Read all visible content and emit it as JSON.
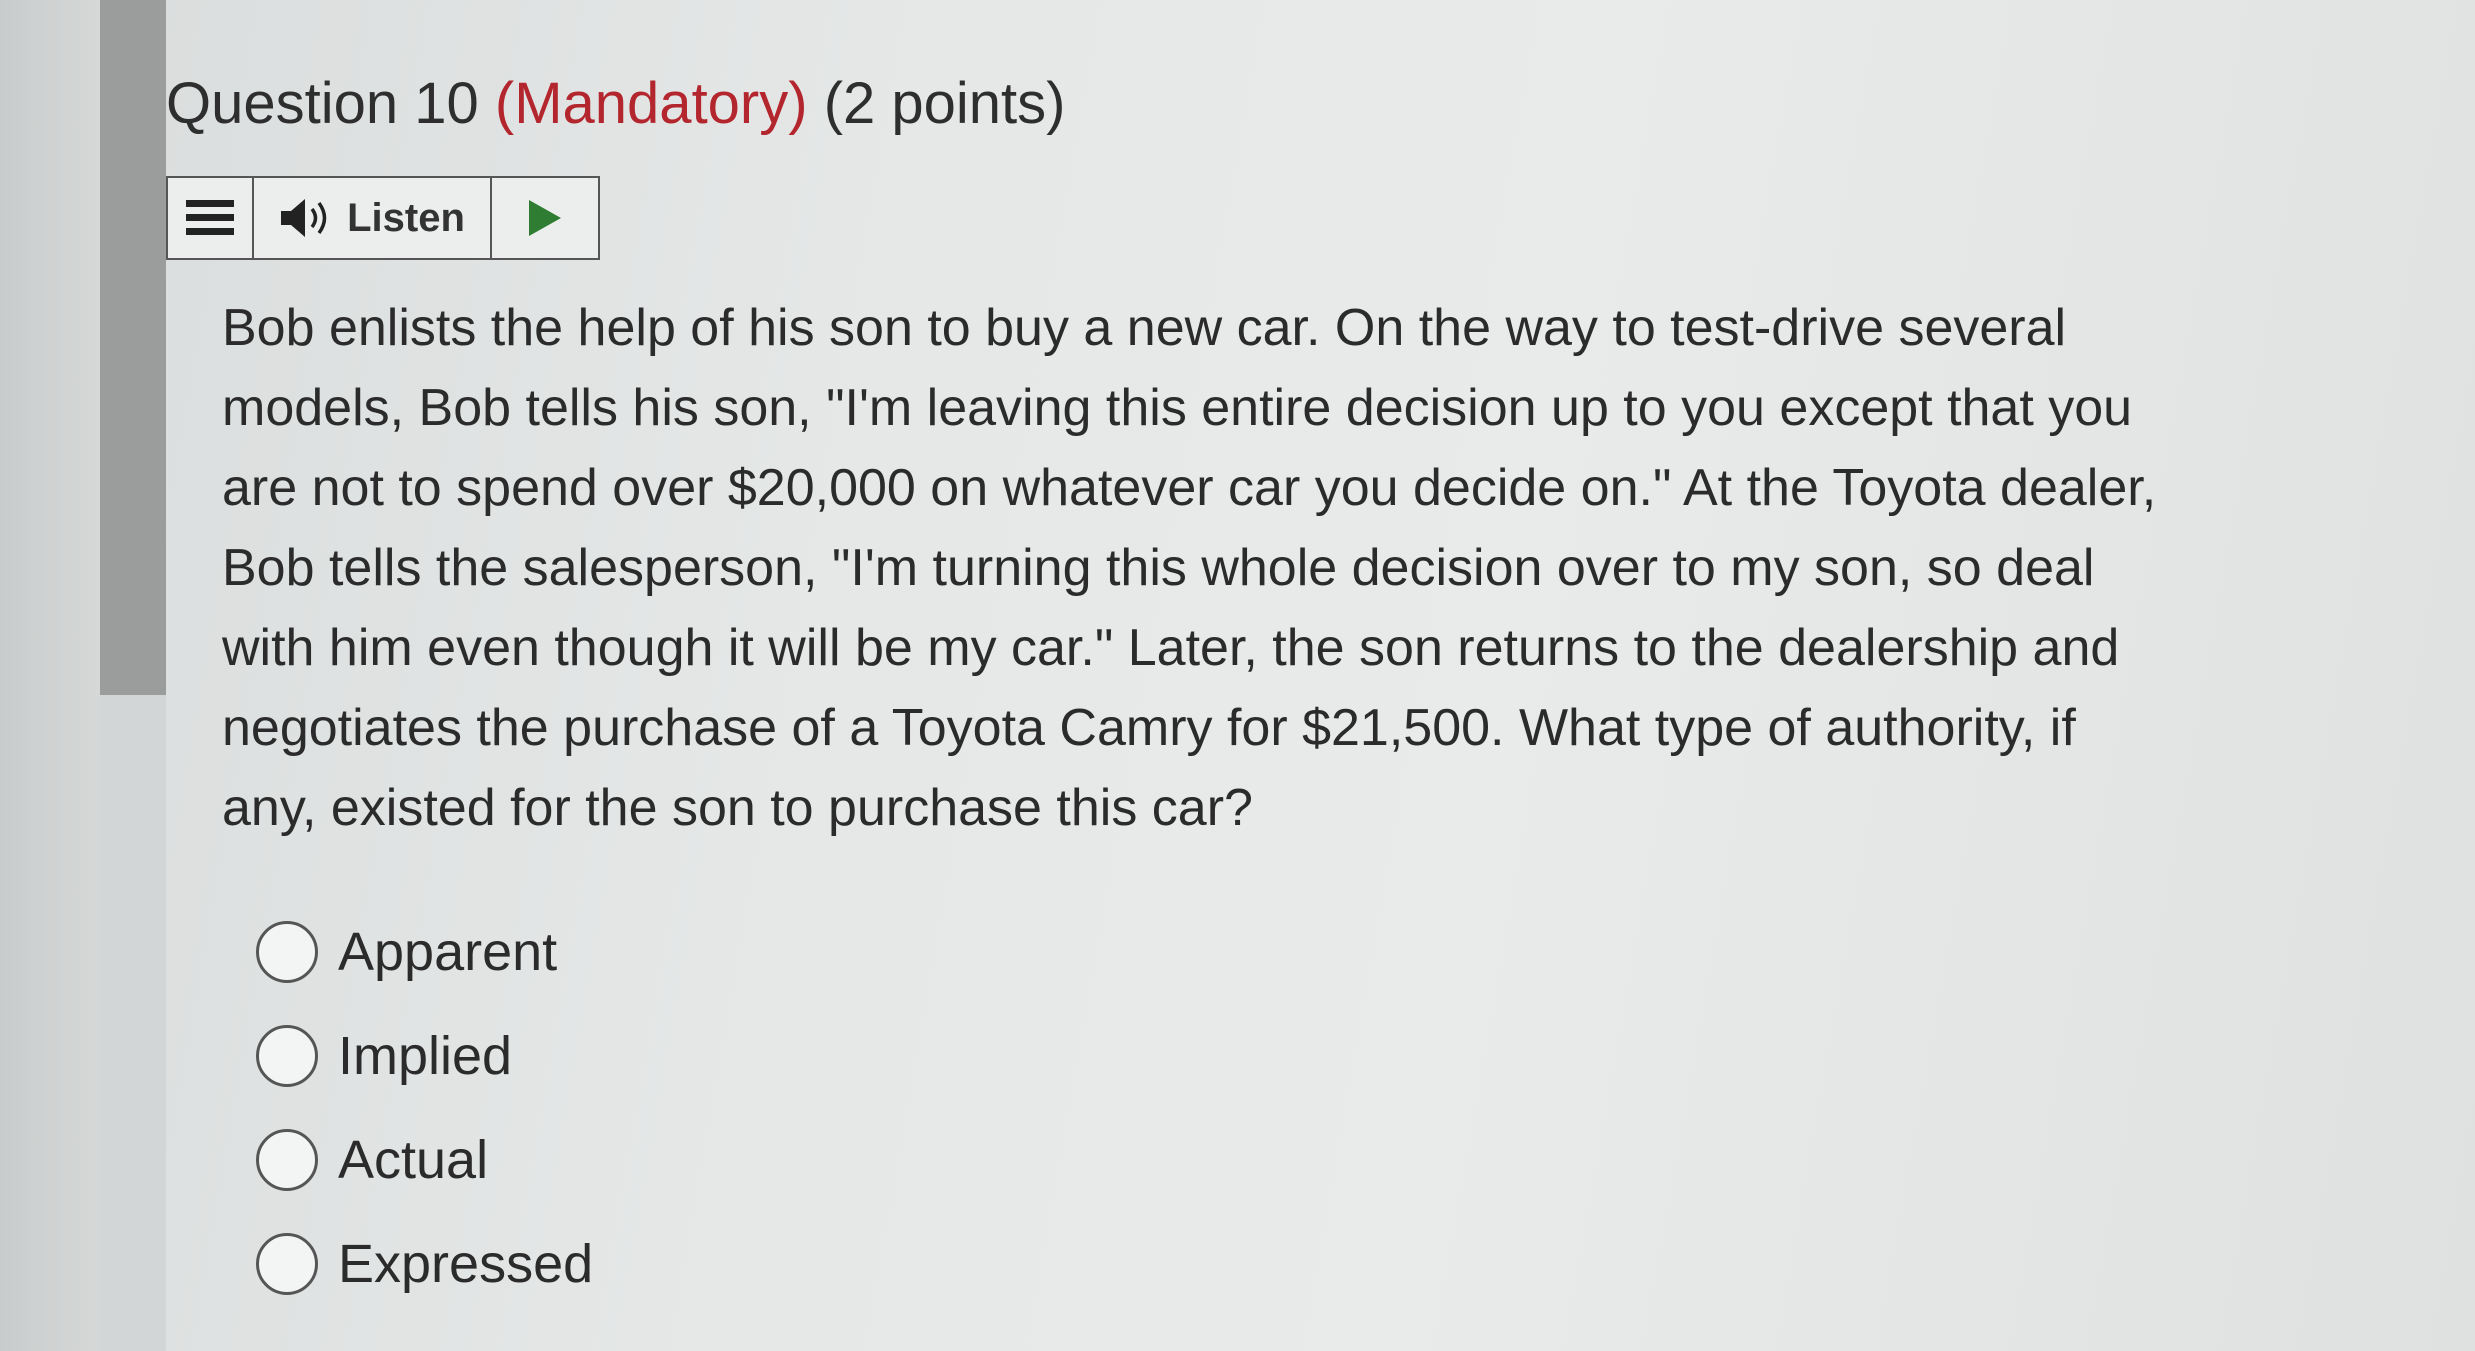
{
  "question": {
    "title_prefix": "Question 10",
    "mandatory_label": "(Mandatory)",
    "points_label": "(2 points)",
    "accent_color": "#b3262d"
  },
  "listen_toolbar": {
    "menu_icon": "hamburger-menu-icon",
    "speaker_icon": "speaker-icon",
    "listen_label": "Listen",
    "play_icon": "play-icon",
    "play_color": "#2f7d32"
  },
  "body": {
    "lines": [
      "Bob enlists the help of his son to buy a new car. On the way to test-drive several",
      "models, Bob tells his son, \"I'm leaving this entire decision up to you except that you",
      "are not to spend over $20,000 on whatever car you decide on.\" At the Toyota dealer,",
      "Bob tells the salesperson, \"I'm turning this whole decision over to my son, so deal",
      "with him even though it will be my car.\" Later, the son returns to the dealership and",
      "negotiates the purchase of a Toyota Camry for $21,500. What type of authority, if",
      "any, existed for the son to purchase this car?"
    ]
  },
  "options": [
    {
      "label": "Apparent",
      "selected": false
    },
    {
      "label": "Implied",
      "selected": false
    },
    {
      "label": "Actual",
      "selected": false
    },
    {
      "label": "Expressed",
      "selected": false
    }
  ]
}
